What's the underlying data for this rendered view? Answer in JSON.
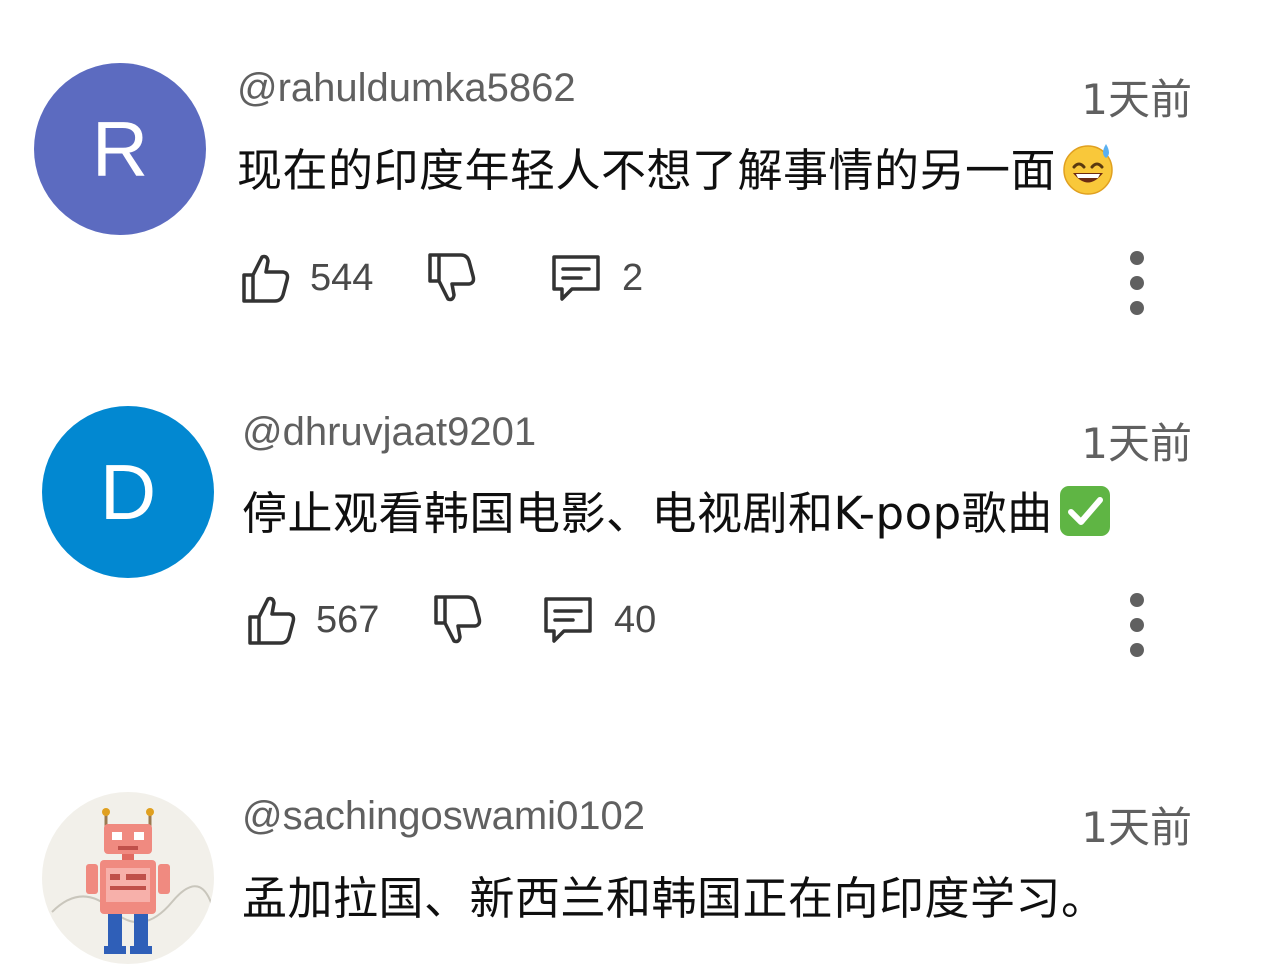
{
  "comments": [
    {
      "avatar_letter": "R",
      "avatar_color": "#5c6bc0",
      "handle": "@rahuldumka5862",
      "time": "1天前",
      "text": "现在的印度年轻人不想了解事情的另一面",
      "emoji": "sweat-smile-emoji",
      "likes": "544",
      "replies": "2"
    },
    {
      "avatar_letter": "D",
      "avatar_color": "#0288d1",
      "handle": "@dhruvjaat9201",
      "time": "1天前",
      "text": "停止观看韩国电影、电视剧和K-pop歌曲",
      "emoji": "check-mark-emoji",
      "likes": "567",
      "replies": "40"
    },
    {
      "avatar_image": "robot-avatar",
      "handle": "@sachingoswami0102",
      "time": "1天前",
      "text": "孟加拉国、新西兰和韩国正在向印度学习。"
    }
  ],
  "icons": {
    "like": "thumbs-up-icon",
    "dislike": "thumbs-down-icon",
    "reply": "comment-icon",
    "more": "more-vert-icon"
  },
  "colors": {
    "secondary_text": "#606060",
    "primary_text": "#0f0f0f"
  }
}
